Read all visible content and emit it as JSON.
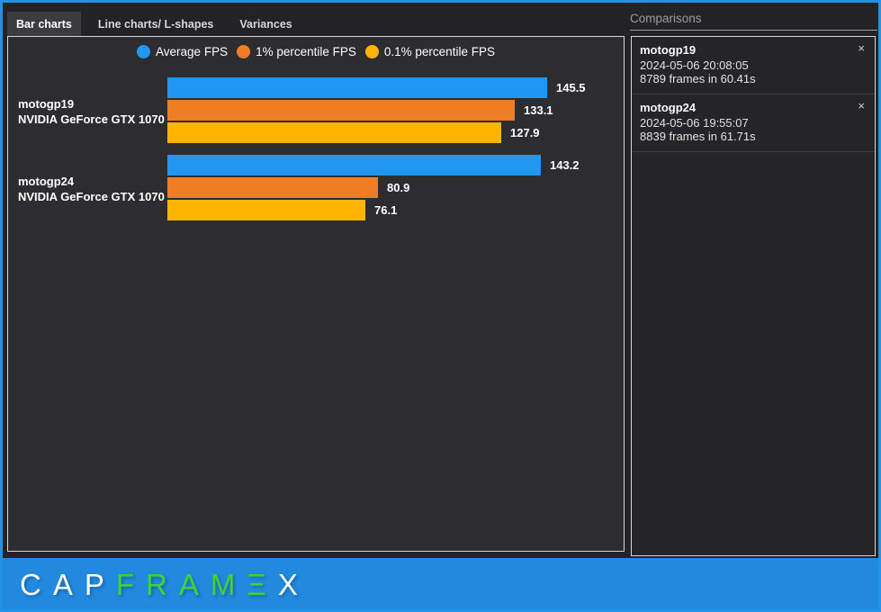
{
  "tabs": [
    {
      "label": "Bar charts",
      "active": true
    },
    {
      "label": "Line charts/ L-shapes",
      "active": false
    },
    {
      "label": "Variances",
      "active": false
    }
  ],
  "chart_data": {
    "type": "bar",
    "orientation": "horizontal",
    "title": "",
    "legend": [
      {
        "label": "Average FPS",
        "color": "#2196F3"
      },
      {
        "label": "1% percentile FPS",
        "color": "#EF7D23"
      },
      {
        "label": "0.1% percentile FPS",
        "color": "#FFB400"
      }
    ],
    "legend_position": "top-center",
    "xlim": [
      0,
      175
    ],
    "grid": false,
    "groups": [
      {
        "title": "motogp19",
        "subtitle": "NVIDIA GeForce GTX 1070",
        "values": [
          145.5,
          133.1,
          127.9
        ]
      },
      {
        "title": "motogp24",
        "subtitle": "NVIDIA GeForce GTX 1070",
        "values": [
          143.2,
          80.9,
          76.1
        ]
      }
    ]
  },
  "comparisons": {
    "title": "Comparisons",
    "close_icon": "×",
    "items": [
      {
        "name": "motogp19",
        "datetime": "2024-05-06 20:08:05",
        "frames": "8789 frames in 60.41s"
      },
      {
        "name": "motogp24",
        "datetime": "2024-05-06 19:55:07",
        "frames": "8839 frames in 61.71s"
      }
    ]
  },
  "footer": {
    "logo_part_cap": "CAP",
    "logo_part_fram": "FRAM",
    "logo_part_e": "Ξ",
    "logo_part_x": "X",
    "background_color": "#2189DE",
    "green_color": "#3FD435"
  }
}
